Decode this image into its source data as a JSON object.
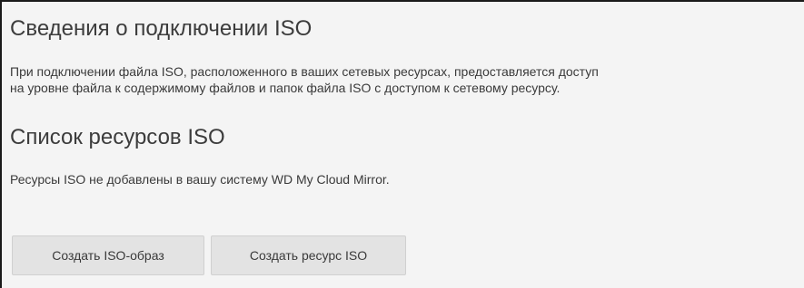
{
  "iso_info": {
    "title": "Сведения о подключении ISO",
    "description_line1": "При подключении файла ISO, расположенного в ваших сетевых ресурсах, предоставляется доступ",
    "description_line2": "на уровне файла к содержимому файлов и папок файла ISO с доступом к сетевому ресурсу."
  },
  "iso_list": {
    "title": "Список ресурсов ISO",
    "empty_message": "Ресурсы ISO не добавлены в вашу систему WD My Cloud Mirror."
  },
  "actions": {
    "create_image_label": "Создать ISO-образ",
    "create_share_label": "Создать ресурс ISO"
  }
}
